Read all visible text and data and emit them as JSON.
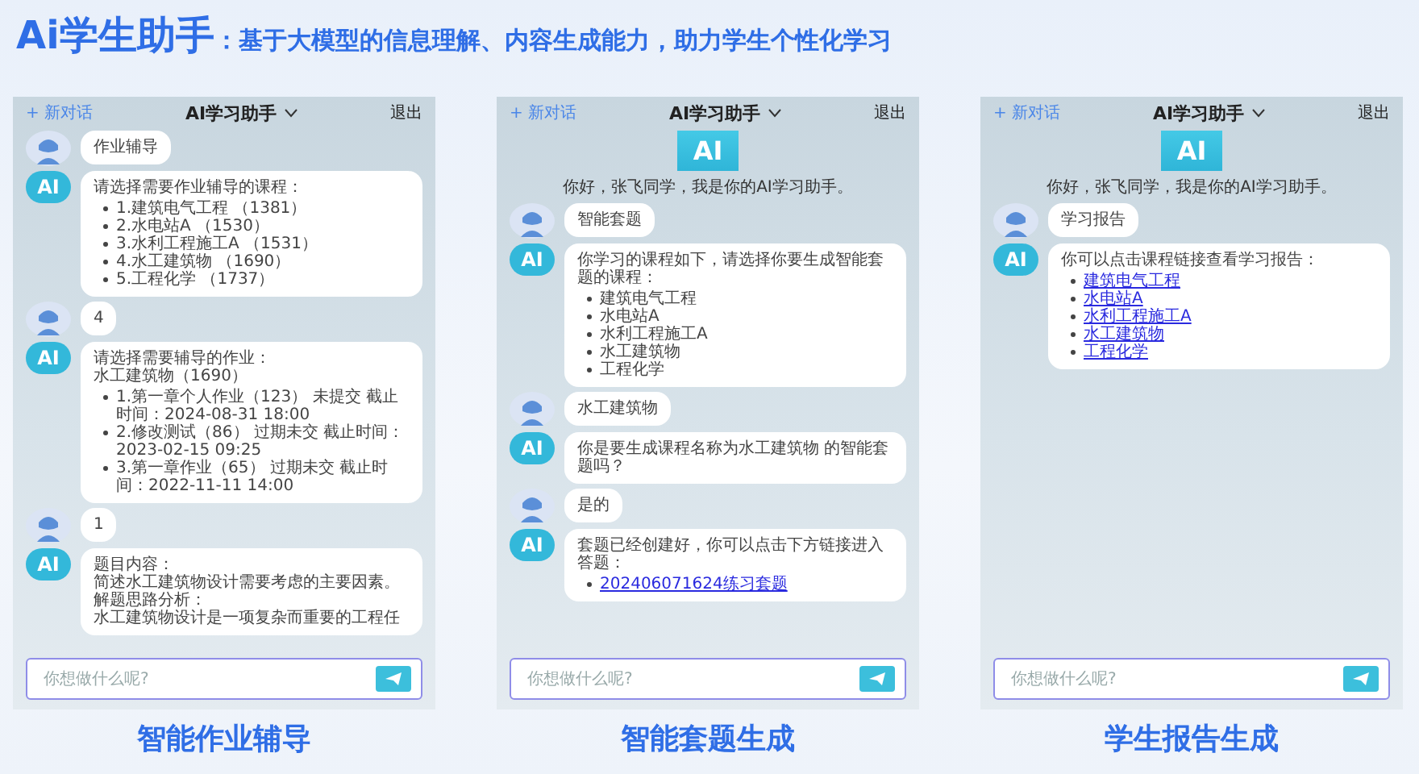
{
  "header": {
    "title": "Ai学生助手",
    "subtitle": "：基于大模型的信息理解、内容生成能力，助力学生个性化学习"
  },
  "panels": [
    {
      "caption": "智能作业辅导",
      "phone": {
        "new_chat": "+ 新对话",
        "title": "AI学习助手",
        "logout": "退出",
        "placeholder": "你想做什么呢?",
        "messages": [
          {
            "kind": "user",
            "lines": [
              "作业辅导"
            ]
          },
          {
            "kind": "ai",
            "avatar": "AI",
            "lines": [
              "请选择需要作业辅导的课程："
            ],
            "items": [
              {
                "text": "1.建筑电气工程 （1381）",
                "link": false
              },
              {
                "text": "2.水电站A （1530）",
                "link": false
              },
              {
                "text": "3.水利工程施工A （1531）",
                "link": false
              },
              {
                "text": "4.水工建筑物 （1690）",
                "link": false
              },
              {
                "text": "5.工程化学 （1737）",
                "link": false
              }
            ]
          },
          {
            "kind": "user",
            "lines": [
              "4"
            ]
          },
          {
            "kind": "ai",
            "avatar": "AI",
            "lines": [
              "请选择需要辅导的作业：",
              "水工建筑物（1690）"
            ],
            "items": [
              {
                "text": "1.第一章个人作业（123） 未提交 截止时间：2024-08-31 18:00",
                "link": false
              },
              {
                "text": "2.修改测试（86） 过期未交 截止时间：2023-02-15 09:25",
                "link": false
              },
              {
                "text": "3.第一章作业（65） 过期未交 截止时间：2022-11-11 14:00",
                "link": false
              }
            ]
          },
          {
            "kind": "user",
            "lines": [
              "1"
            ]
          },
          {
            "kind": "ai",
            "avatar": "AI",
            "lines": [
              "题目内容：",
              "简述水工建筑物设计需要考虑的主要因素。",
              "解题思路分析：",
              "水工建筑物设计是一项复杂而重要的工程任"
            ]
          }
        ]
      }
    },
    {
      "caption": "智能套题生成",
      "phone": {
        "new_chat": "+ 新对话",
        "title": "AI学习助手",
        "logout": "退出",
        "placeholder": "你想做什么呢?",
        "logo": "AI",
        "greeting": "你好，张飞同学，我是你的AI学习助手。",
        "messages": [
          {
            "kind": "user",
            "lines": [
              "智能套题"
            ]
          },
          {
            "kind": "ai",
            "avatar": "AI",
            "lines": [
              "你学习的课程如下，请选择你要生成智能套题的课程："
            ],
            "items": [
              {
                "text": "建筑电气工程",
                "link": false
              },
              {
                "text": "水电站A",
                "link": false
              },
              {
                "text": "水利工程施工A",
                "link": false
              },
              {
                "text": "水工建筑物",
                "link": false
              },
              {
                "text": "工程化学",
                "link": false
              }
            ]
          },
          {
            "kind": "user",
            "lines": [
              "水工建筑物"
            ]
          },
          {
            "kind": "ai",
            "avatar": "AI",
            "lines": [
              "你是要生成课程名称为水工建筑物 的智能套题吗？"
            ]
          },
          {
            "kind": "user",
            "lines": [
              "是的"
            ]
          },
          {
            "kind": "ai",
            "avatar": "AI",
            "lines": [
              "套题已经创建好，你可以点击下方链接进入答题："
            ],
            "items": [
              {
                "text": "202406071624练习套题",
                "link": true
              }
            ]
          }
        ]
      }
    },
    {
      "caption": "学生报告生成",
      "phone": {
        "new_chat": "+ 新对话",
        "title": "AI学习助手",
        "logout": "退出",
        "placeholder": "你想做什么呢?",
        "logo": "AI",
        "greeting": "你好，张飞同学，我是你的AI学习助手。",
        "messages": [
          {
            "kind": "user",
            "lines": [
              "学习报告"
            ]
          },
          {
            "kind": "ai",
            "avatar": "AI",
            "lines": [
              "你可以点击课程链接查看学习报告："
            ],
            "items": [
              {
                "text": "建筑电气工程",
                "link": true
              },
              {
                "text": "水电站A",
                "link": true
              },
              {
                "text": "水利工程施工A",
                "link": true
              },
              {
                "text": "水工建筑物",
                "link": true
              },
              {
                "text": "工程化学",
                "link": true
              }
            ]
          }
        ]
      }
    }
  ]
}
